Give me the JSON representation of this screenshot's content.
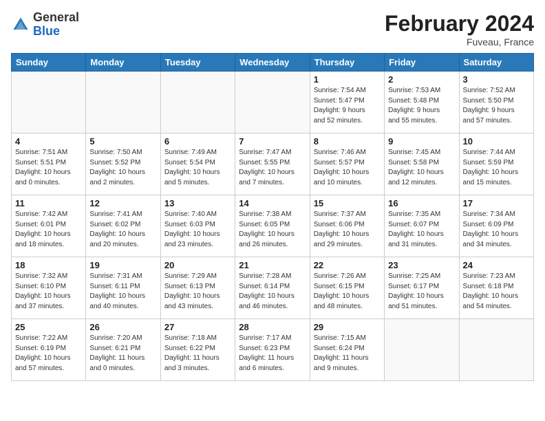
{
  "header": {
    "logo": {
      "general": "General",
      "blue": "Blue"
    },
    "title": "February 2024",
    "location": "Fuveau, France"
  },
  "days_of_week": [
    "Sunday",
    "Monday",
    "Tuesday",
    "Wednesday",
    "Thursday",
    "Friday",
    "Saturday"
  ],
  "weeks": [
    [
      {
        "num": "",
        "info": ""
      },
      {
        "num": "",
        "info": ""
      },
      {
        "num": "",
        "info": ""
      },
      {
        "num": "",
        "info": ""
      },
      {
        "num": "1",
        "info": "Sunrise: 7:54 AM\nSunset: 5:47 PM\nDaylight: 9 hours\nand 52 minutes."
      },
      {
        "num": "2",
        "info": "Sunrise: 7:53 AM\nSunset: 5:48 PM\nDaylight: 9 hours\nand 55 minutes."
      },
      {
        "num": "3",
        "info": "Sunrise: 7:52 AM\nSunset: 5:50 PM\nDaylight: 9 hours\nand 57 minutes."
      }
    ],
    [
      {
        "num": "4",
        "info": "Sunrise: 7:51 AM\nSunset: 5:51 PM\nDaylight: 10 hours\nand 0 minutes."
      },
      {
        "num": "5",
        "info": "Sunrise: 7:50 AM\nSunset: 5:52 PM\nDaylight: 10 hours\nand 2 minutes."
      },
      {
        "num": "6",
        "info": "Sunrise: 7:49 AM\nSunset: 5:54 PM\nDaylight: 10 hours\nand 5 minutes."
      },
      {
        "num": "7",
        "info": "Sunrise: 7:47 AM\nSunset: 5:55 PM\nDaylight: 10 hours\nand 7 minutes."
      },
      {
        "num": "8",
        "info": "Sunrise: 7:46 AM\nSunset: 5:57 PM\nDaylight: 10 hours\nand 10 minutes."
      },
      {
        "num": "9",
        "info": "Sunrise: 7:45 AM\nSunset: 5:58 PM\nDaylight: 10 hours\nand 12 minutes."
      },
      {
        "num": "10",
        "info": "Sunrise: 7:44 AM\nSunset: 5:59 PM\nDaylight: 10 hours\nand 15 minutes."
      }
    ],
    [
      {
        "num": "11",
        "info": "Sunrise: 7:42 AM\nSunset: 6:01 PM\nDaylight: 10 hours\nand 18 minutes."
      },
      {
        "num": "12",
        "info": "Sunrise: 7:41 AM\nSunset: 6:02 PM\nDaylight: 10 hours\nand 20 minutes."
      },
      {
        "num": "13",
        "info": "Sunrise: 7:40 AM\nSunset: 6:03 PM\nDaylight: 10 hours\nand 23 minutes."
      },
      {
        "num": "14",
        "info": "Sunrise: 7:38 AM\nSunset: 6:05 PM\nDaylight: 10 hours\nand 26 minutes."
      },
      {
        "num": "15",
        "info": "Sunrise: 7:37 AM\nSunset: 6:06 PM\nDaylight: 10 hours\nand 29 minutes."
      },
      {
        "num": "16",
        "info": "Sunrise: 7:35 AM\nSunset: 6:07 PM\nDaylight: 10 hours\nand 31 minutes."
      },
      {
        "num": "17",
        "info": "Sunrise: 7:34 AM\nSunset: 6:09 PM\nDaylight: 10 hours\nand 34 minutes."
      }
    ],
    [
      {
        "num": "18",
        "info": "Sunrise: 7:32 AM\nSunset: 6:10 PM\nDaylight: 10 hours\nand 37 minutes."
      },
      {
        "num": "19",
        "info": "Sunrise: 7:31 AM\nSunset: 6:11 PM\nDaylight: 10 hours\nand 40 minutes."
      },
      {
        "num": "20",
        "info": "Sunrise: 7:29 AM\nSunset: 6:13 PM\nDaylight: 10 hours\nand 43 minutes."
      },
      {
        "num": "21",
        "info": "Sunrise: 7:28 AM\nSunset: 6:14 PM\nDaylight: 10 hours\nand 46 minutes."
      },
      {
        "num": "22",
        "info": "Sunrise: 7:26 AM\nSunset: 6:15 PM\nDaylight: 10 hours\nand 48 minutes."
      },
      {
        "num": "23",
        "info": "Sunrise: 7:25 AM\nSunset: 6:17 PM\nDaylight: 10 hours\nand 51 minutes."
      },
      {
        "num": "24",
        "info": "Sunrise: 7:23 AM\nSunset: 6:18 PM\nDaylight: 10 hours\nand 54 minutes."
      }
    ],
    [
      {
        "num": "25",
        "info": "Sunrise: 7:22 AM\nSunset: 6:19 PM\nDaylight: 10 hours\nand 57 minutes."
      },
      {
        "num": "26",
        "info": "Sunrise: 7:20 AM\nSunset: 6:21 PM\nDaylight: 11 hours\nand 0 minutes."
      },
      {
        "num": "27",
        "info": "Sunrise: 7:18 AM\nSunset: 6:22 PM\nDaylight: 11 hours\nand 3 minutes."
      },
      {
        "num": "28",
        "info": "Sunrise: 7:17 AM\nSunset: 6:23 PM\nDaylight: 11 hours\nand 6 minutes."
      },
      {
        "num": "29",
        "info": "Sunrise: 7:15 AM\nSunset: 6:24 PM\nDaylight: 11 hours\nand 9 minutes."
      },
      {
        "num": "",
        "info": ""
      },
      {
        "num": "",
        "info": ""
      }
    ]
  ]
}
